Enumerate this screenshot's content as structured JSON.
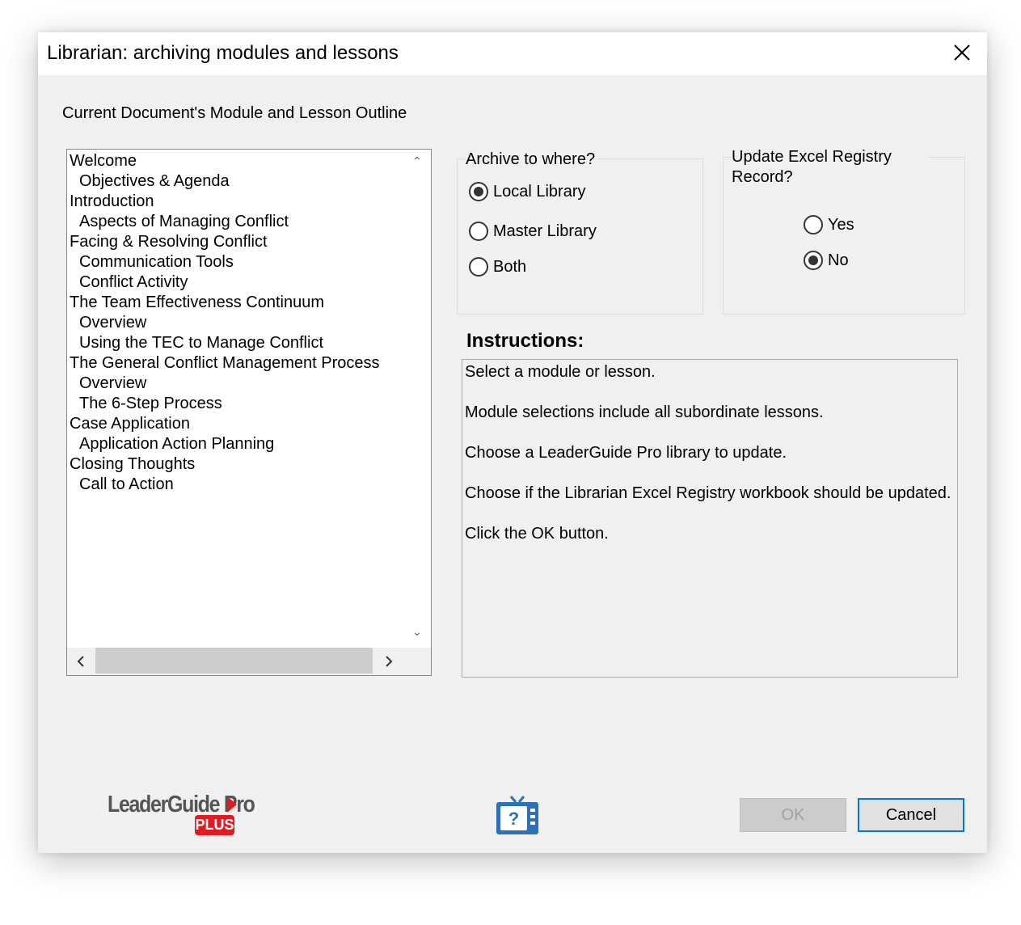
{
  "window": {
    "title": "Librarian: archiving modules and lessons"
  },
  "outline": {
    "label": "Current Document's Module and Lesson Outline",
    "items": [
      {
        "text": "Welcome",
        "level": 0
      },
      {
        "text": "Objectives & Agenda",
        "level": 1
      },
      {
        "text": "Introduction",
        "level": 0
      },
      {
        "text": "Aspects of Managing Conflict",
        "level": 1
      },
      {
        "text": "Facing & Resolving Conflict",
        "level": 0
      },
      {
        "text": "Communication Tools",
        "level": 1
      },
      {
        "text": "Conflict Activity",
        "level": 1
      },
      {
        "text": "The Team Effectiveness Continuum",
        "level": 0
      },
      {
        "text": "Overview",
        "level": 1
      },
      {
        "text": "Using the TEC to Manage Conflict",
        "level": 1
      },
      {
        "text": "The General Conflict Management Process",
        "level": 0
      },
      {
        "text": "Overview",
        "level": 1
      },
      {
        "text": "The 6-Step Process",
        "level": 1
      },
      {
        "text": "Case Application",
        "level": 0
      },
      {
        "text": "Application Action Planning",
        "level": 1
      },
      {
        "text": "Closing Thoughts",
        "level": 0
      },
      {
        "text": "Call to Action",
        "level": 1
      }
    ]
  },
  "archive": {
    "title": "Archive to where?",
    "options": [
      {
        "label": "Local Library",
        "checked": true
      },
      {
        "label": "Master Library",
        "checked": false
      },
      {
        "label": "Both",
        "checked": false
      }
    ]
  },
  "registry": {
    "title": "Update Excel Registry Record?",
    "options": [
      {
        "label": "Yes",
        "checked": false
      },
      {
        "label": "No",
        "checked": true
      }
    ]
  },
  "instructions": {
    "title": "Instructions:",
    "lines": [
      "Select a module or lesson.",
      "Module selections include all subordinate lessons.",
      "Choose a LeaderGuide Pro library to update.",
      "Choose if the Librarian Excel Registry workbook should be updated.",
      "Click the OK  button."
    ]
  },
  "logo": {
    "name": "LeaderGuide Pro",
    "badge": "PLUS"
  },
  "buttons": {
    "ok": "OK",
    "cancel": "Cancel"
  },
  "colors": {
    "accent": "#0078d7",
    "logo_red": "#e11b22",
    "help_blue": "#2f6fb5"
  }
}
